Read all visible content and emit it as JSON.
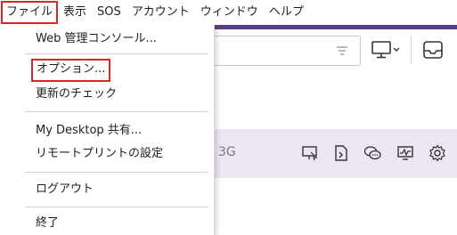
{
  "menubar": {
    "items": [
      "ファイル",
      "表示",
      "SOS",
      "アカウント",
      "ウィンドウ",
      "ヘルプ"
    ]
  },
  "file_menu": {
    "web_console": "Web 管理コンソール...",
    "options": "オプション...",
    "check_updates": "更新のチェック",
    "my_desktop_share": "My Desktop 共有...",
    "remote_print_settings": "リモートプリントの設定",
    "logout": "ログアウト",
    "exit": "終了"
  },
  "background": {
    "band_text": "3G"
  },
  "icons": {
    "filter": "filter-icon",
    "monitor": "monitor-icon",
    "inbox": "inbox-icon",
    "band_icons": [
      "remote-monitor-icon",
      "file-transfer-icon",
      "chat-icon",
      "system-info-icon",
      "settings-gear-icon"
    ]
  },
  "colors": {
    "accent_purple": "#5b3d86",
    "band_purple": "#ece6f2",
    "highlight_red": "#d92626"
  }
}
